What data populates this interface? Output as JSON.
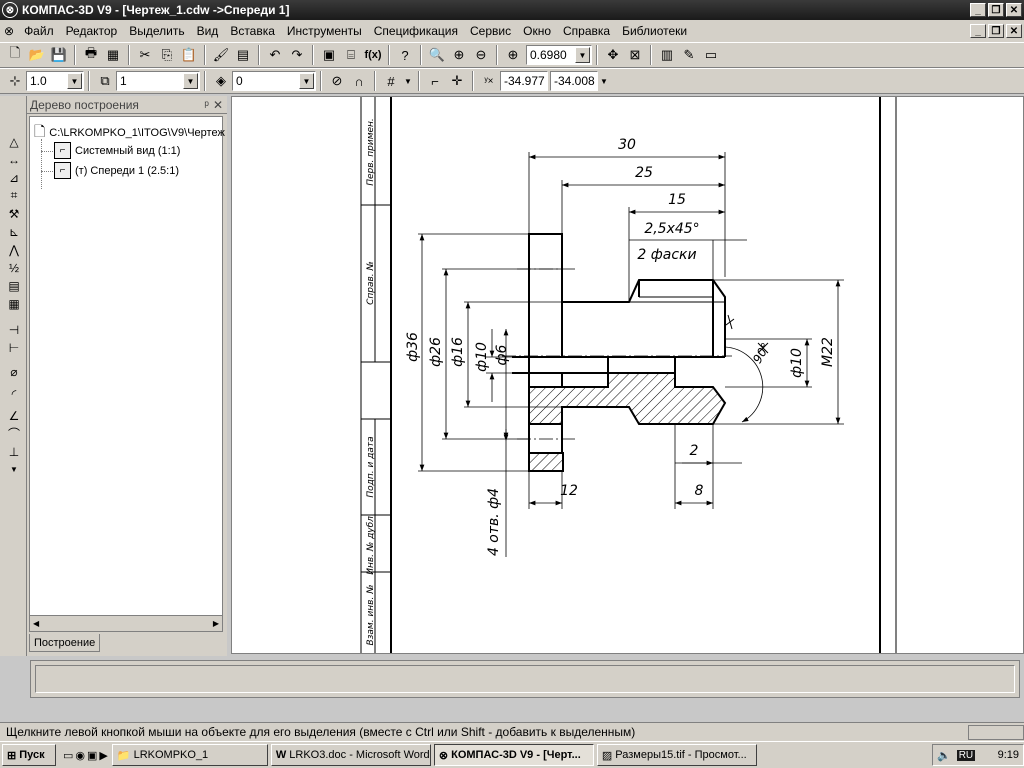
{
  "window": {
    "title": "КОМПАС-3D V9 - [Чертеж_1.cdw ->Спереди 1]"
  },
  "menu": [
    "Файл",
    "Редактор",
    "Выделить",
    "Вид",
    "Вставка",
    "Инструменты",
    "Спецификация",
    "Сервис",
    "Окно",
    "Справка",
    "Библиотеки"
  ],
  "toolbar1": {
    "zoom_value": "0.6980"
  },
  "toolbar2": {
    "step_value": "1.0",
    "layer_value": "1",
    "style_value": "0",
    "coord_x": "-34.977",
    "coord_y": "-34.008"
  },
  "tree": {
    "title": "Дерево построения",
    "root": "C:\\LRKOMPKO_1\\ITOG\\V9\\Чертеж",
    "nodes": [
      "Системный вид (1:1)",
      "(т) Спереди 1 (2.5:1)"
    ],
    "tab": "Построение"
  },
  "drawing": {
    "dims": {
      "d30": "30",
      "d25": "25",
      "d15": "15",
      "chamfer": "2,5х45°",
      "chamfer_note": "2 фаски",
      "phi36": "ф36",
      "phi26": "ф26",
      "phi16": "ф16",
      "phi10a": "ф10",
      "phi6": "ф6",
      "phi10b": "ф10",
      "m22": "M22",
      "angle": "90°",
      "d2": "2",
      "d12": "12",
      "d8": "8",
      "holes": "4 отв. ф4"
    },
    "stamp": [
      "Перв. примен.",
      "Справ. №",
      "Подп. и дата",
      "Инв. № дубл.",
      "Взам. инв. №"
    ]
  },
  "status_text": "Щелкните левой кнопкой мыши на объекте для его выделения (вместе с Ctrl или Shift - добавить к выделенным)",
  "taskbar": {
    "start": "Пуск",
    "tasks": [
      "LRKOMPKO_1",
      "LRKO3.doc - Microsoft Word",
      "КОМПАС-3D V9 - [Черт...",
      "Размеры15.tif - Просмот..."
    ],
    "lang": "RU",
    "clock": "9:19"
  }
}
